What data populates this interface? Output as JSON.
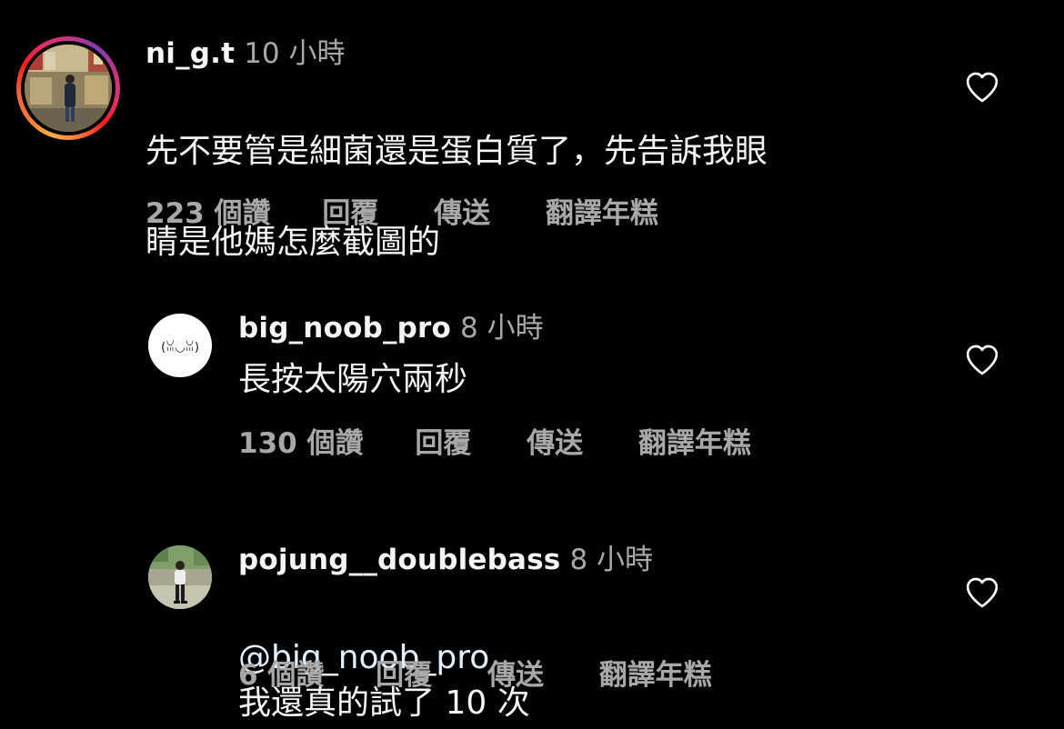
{
  "colors": {
    "background": "#000000",
    "text_primary": "#f5f5f5",
    "text_secondary": "#a8a8a8",
    "heart_outline": "#ffffff"
  },
  "comments": [
    {
      "username": "ni_g.t",
      "time": "10 小時",
      "text_line1": "先不要管是細菌還是蛋白質了，先告訴我眼",
      "text_line2": "睛是他媽怎麼截圖的",
      "likes": "223 個讚",
      "reply": "回覆",
      "send": "傳送",
      "translate": "翻譯年糕",
      "avatar_icon": "profile-photo",
      "has_story_ring": true
    },
    {
      "username": "big_noob_pro",
      "time": "8 小時",
      "text": "長按太陽穴兩秒",
      "likes": "130 個讚",
      "reply": "回覆",
      "send": "傳送",
      "translate": "翻譯年糕",
      "avatar_face": "(ꈍ◡ꈍ)"
    },
    {
      "username": "pojung__doublebass",
      "time": "8 小時",
      "mention": "@big_noob_pro",
      "text": "我還真的試了 10 次",
      "likes": "6 個讚",
      "reply": "回覆",
      "send": "傳送",
      "translate": "翻譯年糕",
      "avatar_icon": "profile-photo"
    }
  ]
}
